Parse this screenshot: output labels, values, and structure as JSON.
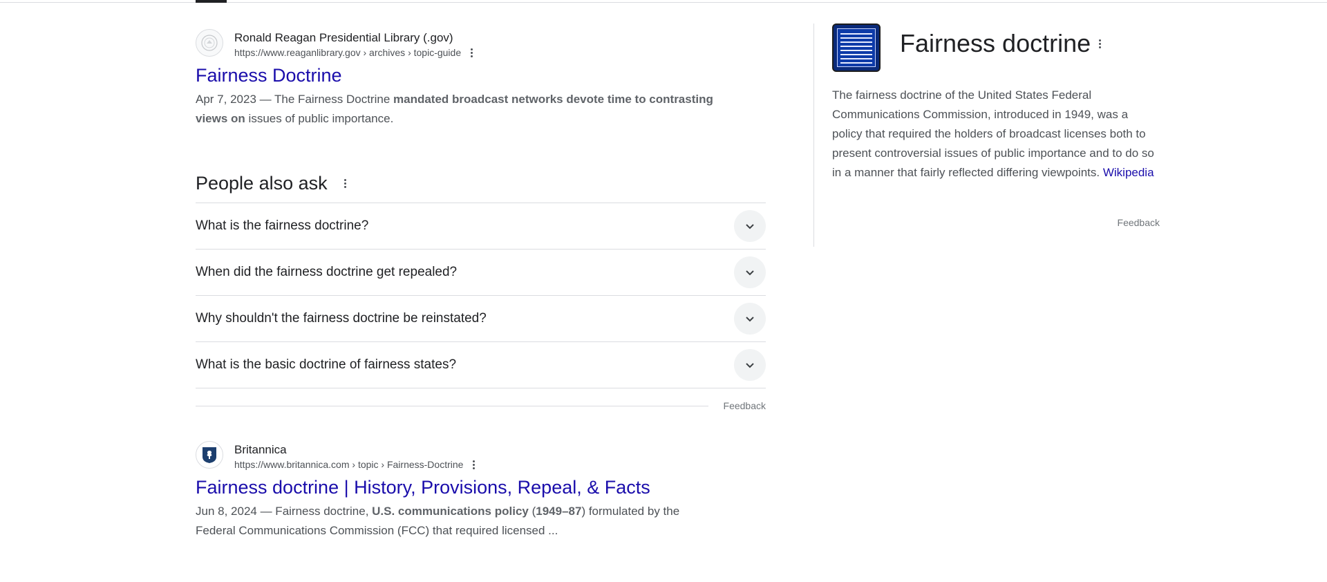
{
  "results": [
    {
      "site_name": "Ronald Reagan Presidential Library (.gov)",
      "url": "https://www.reaganlibrary.gov › archives › topic-guide",
      "title": "Fairness Doctrine",
      "snippet_date": "Apr 7, 2023",
      "snippet_pre": " — The Fairness Doctrine ",
      "snippet_bold": "mandated broadcast networks devote time to contrasting views on",
      "snippet_post": " issues of public importance.",
      "favicon_icon": "seal-icon"
    },
    {
      "site_name": "Britannica",
      "url": "https://www.britannica.com › topic › Fairness-Doctrine",
      "title": "Fairness doctrine | History, Provisions, Repeal, & Facts",
      "snippet_date": "Jun 8, 2024",
      "snippet_pre": " — Fairness doctrine, ",
      "snippet_bold": "U.S. communications policy",
      "snippet_mid": " (",
      "snippet_bold2": "1949–87",
      "snippet_post": ") formulated by the Federal Communications Commission (FCC) that required licensed ...",
      "favicon_icon": "britannica-thistle-icon"
    }
  ],
  "people_also_ask": {
    "title": "People also ask",
    "questions": [
      "What is the fairness doctrine?",
      "When did the fairness doctrine get repealed?",
      "Why shouldn't the fairness doctrine be reinstated?",
      "What is the basic doctrine of fairness states?"
    ],
    "feedback": "Feedback"
  },
  "knowledge_panel": {
    "title": "Fairness doctrine",
    "description": "The fairness doctrine of the United States Federal Communications Commission, introduced in 1949, was a policy that required the holders of broadcast licenses both to present controversial issues of public importance and to do so in a manner that fairly reflected differing viewpoints. ",
    "source": "Wikipedia",
    "feedback": "Feedback",
    "thumb_icon": "fairness-doctrine-poster-thumbnail"
  },
  "colors": {
    "link": "#1a0dab",
    "text": "#202124",
    "secondary": "#4d5156",
    "divider": "#dadce0"
  }
}
